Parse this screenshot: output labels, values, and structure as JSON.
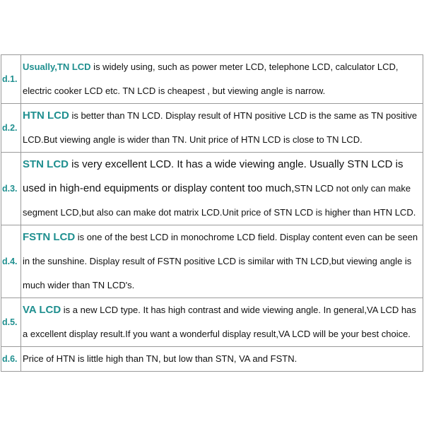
{
  "rows": [
    {
      "label": "d.1.",
      "term": "Usually,TN LCD",
      "text": " is widely using, such as power meter LCD, telephone LCD, calculator LCD, electric cooker LCD etc. TN LCD is cheapest , but viewing angle is narrow."
    },
    {
      "label": "d.2.",
      "term": "HTN LCD",
      "text": " is better than TN LCD. Display result of HTN positive LCD is the same as TN positive LCD.But viewing angle is wider than TN. Unit price of HTN LCD is close to TN LCD."
    },
    {
      "label": "d.3.",
      "term": "STN LCD",
      "text_first": " is very excellent LCD. It has a wide viewing angle. Usually STN LCD is used in high-end equipments or display content too much,",
      "text_rest": "STN LCD not only can make segment LCD,but also can make dot matrix LCD.Unit price of STN LCD is higher than HTN LCD."
    },
    {
      "label": "d.4.",
      "term": "FSTN LCD",
      "text": " is one of the best LCD in monochrome LCD field. Display content even can be seen in the sunshine. Display result of FSTN positive LCD is similar with TN LCD,but viewing angle is much wider than TN LCD's."
    },
    {
      "label": "d.5.",
      "term": "VA LCD",
      "text": " is a new LCD type. It has high contrast and wide viewing angle. In general,VA LCD has a excellent display result.If you want a wonderful display result,VA LCD will be your best choice."
    },
    {
      "label": "d.6.",
      "text": "Price of HTN is little high than TN, but low than STN, VA and FSTN."
    }
  ]
}
